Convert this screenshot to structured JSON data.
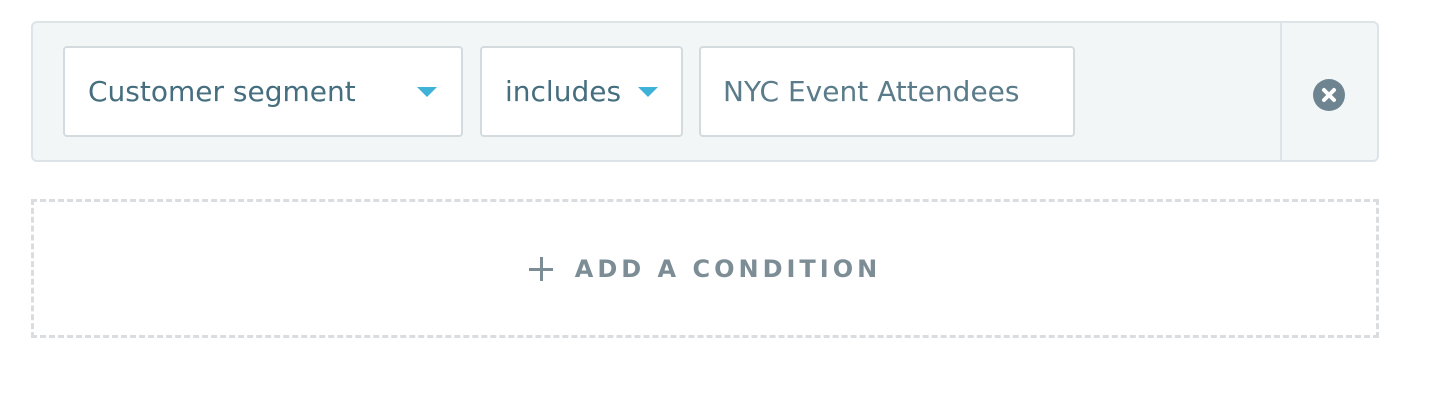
{
  "condition": {
    "field_select": {
      "value": "Customer segment"
    },
    "operator_select": {
      "value": "includes"
    },
    "value_input": {
      "value": "NYC Event Attendees"
    },
    "remove_icon": "close-circle-icon"
  },
  "add_condition": {
    "label": "ADD A CONDITION",
    "icon": "plus-icon"
  },
  "colors": {
    "accent": "#3fb2d8",
    "text": "#456f7f",
    "row_bg": "#f3f6f7",
    "muted": "#7d8d96"
  }
}
